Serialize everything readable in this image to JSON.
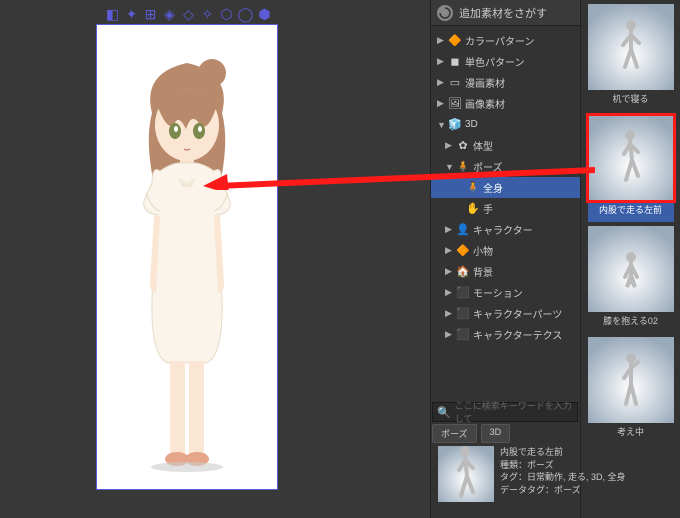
{
  "header": {
    "search_materials": "追加素材をさがす"
  },
  "tree": {
    "color_pattern": "カラーパターン",
    "mono_pattern": "単色パターン",
    "manga": "漫画素材",
    "image": "画像素材",
    "three_d": "3D",
    "body": "体型",
    "pose": "ポーズ",
    "full_body": "全身",
    "hand": "手",
    "character": "キャラクター",
    "small_items": "小物",
    "background": "背景",
    "motion": "モーション",
    "char_parts": "キャラクターパーツ",
    "char_tex": "キャラクターテクス"
  },
  "keyword_search": {
    "placeholder": "ここに検索キーワードを入力して"
  },
  "filters": {
    "pose": "ポーズ",
    "three_d": "3D"
  },
  "thumbs": {
    "t1": "机で寝る",
    "t2": "内股で走る左前",
    "t3": "膝を抱える02",
    "t4": "考え中"
  },
  "detail": {
    "title": "内股で走る左前",
    "kind_label": "種類：",
    "kind_value": "ポーズ",
    "tag_label": "タグ：",
    "tag_value": "日常動作, 走る, 3D, 全身",
    "datatag_label": "データタグ：",
    "datatag_value": "ポーズ"
  }
}
